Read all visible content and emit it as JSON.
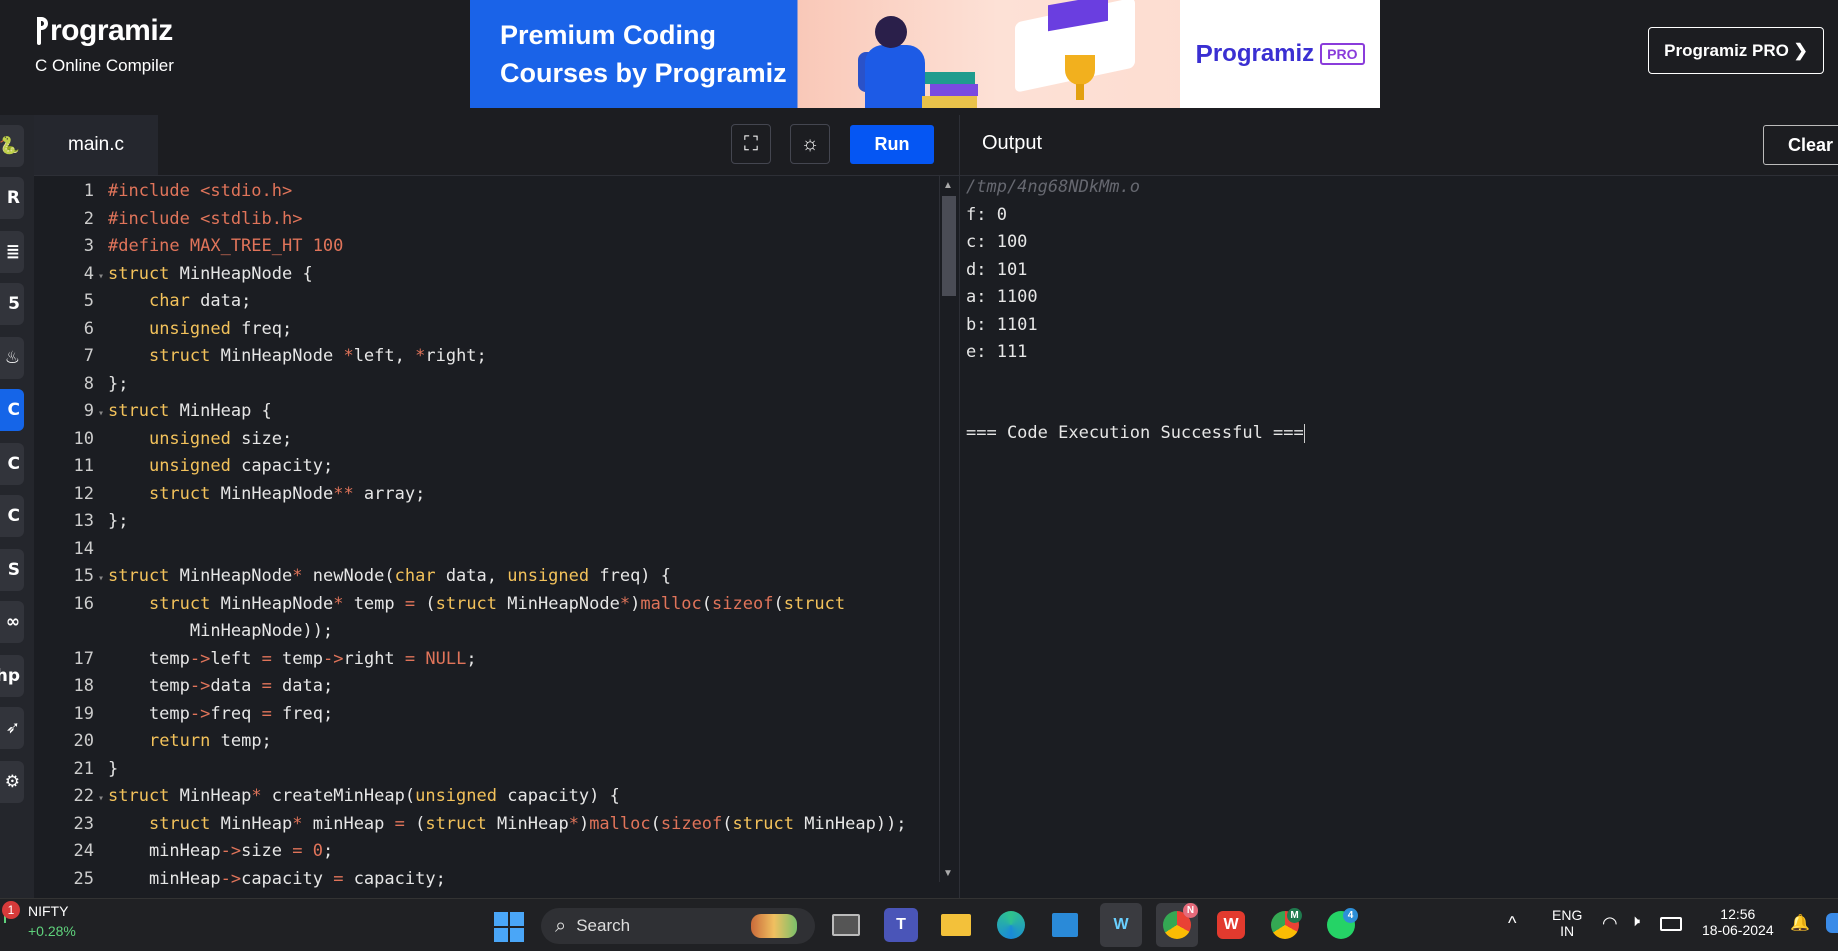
{
  "header": {
    "logo_text": "rogramiz",
    "subtitle": "C Online Compiler",
    "banner_line1": "Premium Coding",
    "banner_line2": "Courses by Programiz",
    "banner_logo": "rogramiz",
    "banner_pro": "PRO",
    "pro_button": "Programiz PRO ❯"
  },
  "rail": {
    "items": [
      {
        "icon": "python-icon",
        "glyph": "🐍"
      },
      {
        "icon": "r-icon",
        "glyph": "R"
      },
      {
        "icon": "sql-icon",
        "glyph": "≣"
      },
      {
        "icon": "html-icon",
        "glyph": "5"
      },
      {
        "icon": "java-icon",
        "glyph": "♨"
      },
      {
        "icon": "c-icon",
        "glyph": "C"
      },
      {
        "icon": "cpp-icon",
        "glyph": "C"
      },
      {
        "icon": "csharp-icon",
        "glyph": "C"
      },
      {
        "icon": "js-icon",
        "glyph": "S"
      },
      {
        "icon": "go-icon",
        "glyph": "∞"
      },
      {
        "icon": "php-icon",
        "glyph": "hp"
      },
      {
        "icon": "swift-icon",
        "glyph": "➶"
      },
      {
        "icon": "rust-icon",
        "glyph": "⚙"
      }
    ]
  },
  "editor": {
    "file_tab": "main.c",
    "run_label": "Run",
    "fullscreen_icon": "⛶",
    "theme_icon": "☼"
  },
  "code_lines": [
    {
      "n": "1",
      "fold": false,
      "html": "<span class='pp'>#include &lt;stdio.h&gt;</span>"
    },
    {
      "n": "2",
      "fold": false,
      "html": "<span class='pp'>#include &lt;stdlib.h&gt;</span>"
    },
    {
      "n": "3",
      "fold": false,
      "html": "<span class='pp'>#define MAX_TREE_HT 100</span>"
    },
    {
      "n": "4",
      "fold": true,
      "html": "<span class='kw'>struct</span> MinHeapNode {"
    },
    {
      "n": "5",
      "fold": false,
      "html": "    <span class='kw'>char</span> data;"
    },
    {
      "n": "6",
      "fold": false,
      "html": "    <span class='kw'>unsigned</span> freq;"
    },
    {
      "n": "7",
      "fold": false,
      "html": "    <span class='kw'>struct</span> MinHeapNode <span class='op'>*</span>left, <span class='op'>*</span>right;"
    },
    {
      "n": "8",
      "fold": false,
      "html": "};"
    },
    {
      "n": "9",
      "fold": true,
      "html": "<span class='kw'>struct</span> MinHeap {"
    },
    {
      "n": "10",
      "fold": false,
      "html": "    <span class='kw'>unsigned</span> size;"
    },
    {
      "n": "11",
      "fold": false,
      "html": "    <span class='kw'>unsigned</span> capacity;"
    },
    {
      "n": "12",
      "fold": false,
      "html": "    <span class='kw'>struct</span> MinHeapNode<span class='op'>**</span> array;"
    },
    {
      "n": "13",
      "fold": false,
      "html": "};"
    },
    {
      "n": "14",
      "fold": false,
      "html": ""
    },
    {
      "n": "15",
      "fold": true,
      "html": "<span class='kw'>struct</span> MinHeapNode<span class='op'>*</span> newNode(<span class='kw'>char</span> data, <span class='kw'>unsigned</span> freq) {"
    },
    {
      "n": "16",
      "fold": false,
      "html": "    <span class='kw'>struct</span> MinHeapNode<span class='op'>*</span> temp <span class='op'>=</span> (<span class='kw'>struct</span> MinHeapNode<span class='op'>*</span>)<span class='pp'>malloc</span>(<span class='pp'>sizeof</span>(<span class='kw'>struct</span>"
    },
    {
      "n": "",
      "fold": false,
      "html": "        MinHeapNode));"
    },
    {
      "n": "17",
      "fold": false,
      "html": "    temp<span class='op'>-&gt;</span>left <span class='op'>=</span> temp<span class='op'>-&gt;</span>right <span class='op'>=</span> <span class='num'>NULL</span>;"
    },
    {
      "n": "18",
      "fold": false,
      "html": "    temp<span class='op'>-&gt;</span>data <span class='op'>=</span> data;"
    },
    {
      "n": "19",
      "fold": false,
      "html": "    temp<span class='op'>-&gt;</span>freq <span class='op'>=</span> freq;"
    },
    {
      "n": "20",
      "fold": false,
      "html": "    <span class='kw'>return</span> temp;"
    },
    {
      "n": "21",
      "fold": false,
      "html": "}"
    },
    {
      "n": "22",
      "fold": true,
      "html": "<span class='kw'>struct</span> MinHeap<span class='op'>*</span> createMinHeap(<span class='kw'>unsigned</span> capacity) {"
    },
    {
      "n": "23",
      "fold": false,
      "html": "    <span class='kw'>struct</span> MinHeap<span class='op'>*</span> minHeap <span class='op'>=</span> (<span class='kw'>struct</span> MinHeap<span class='op'>*</span>)<span class='pp'>malloc</span>(<span class='pp'>sizeof</span>(<span class='kw'>struct</span> MinHeap));"
    },
    {
      "n": "24",
      "fold": false,
      "html": "    minHeap<span class='op'>-&gt;</span>size <span class='op'>=</span> <span class='num'>0</span>;"
    },
    {
      "n": "25",
      "fold": false,
      "html": "    minHeap<span class='op'>-&gt;</span>capacity <span class='op'>=</span> capacity;"
    }
  ],
  "output": {
    "title": "Output",
    "clear_label": "Clear",
    "path": "/tmp/4ng68NDkMm.o",
    "lines": [
      "f: 0",
      "c: 100",
      "d: 101",
      "a: 1100",
      "b: 1101",
      "e: 111"
    ],
    "result": "=== Code Execution Successful ==="
  },
  "taskbar": {
    "nifty_badge": "1",
    "nifty_name": "NIFTY",
    "nifty_change": "+0.28%",
    "search_placeholder": "Search",
    "lang_line1": "ENG",
    "lang_line2": "IN",
    "time": "12:56",
    "date": "18-06-2024",
    "chrome_badge": "N",
    "chrome2_badge": "M",
    "whatsapp_badge": "4"
  }
}
